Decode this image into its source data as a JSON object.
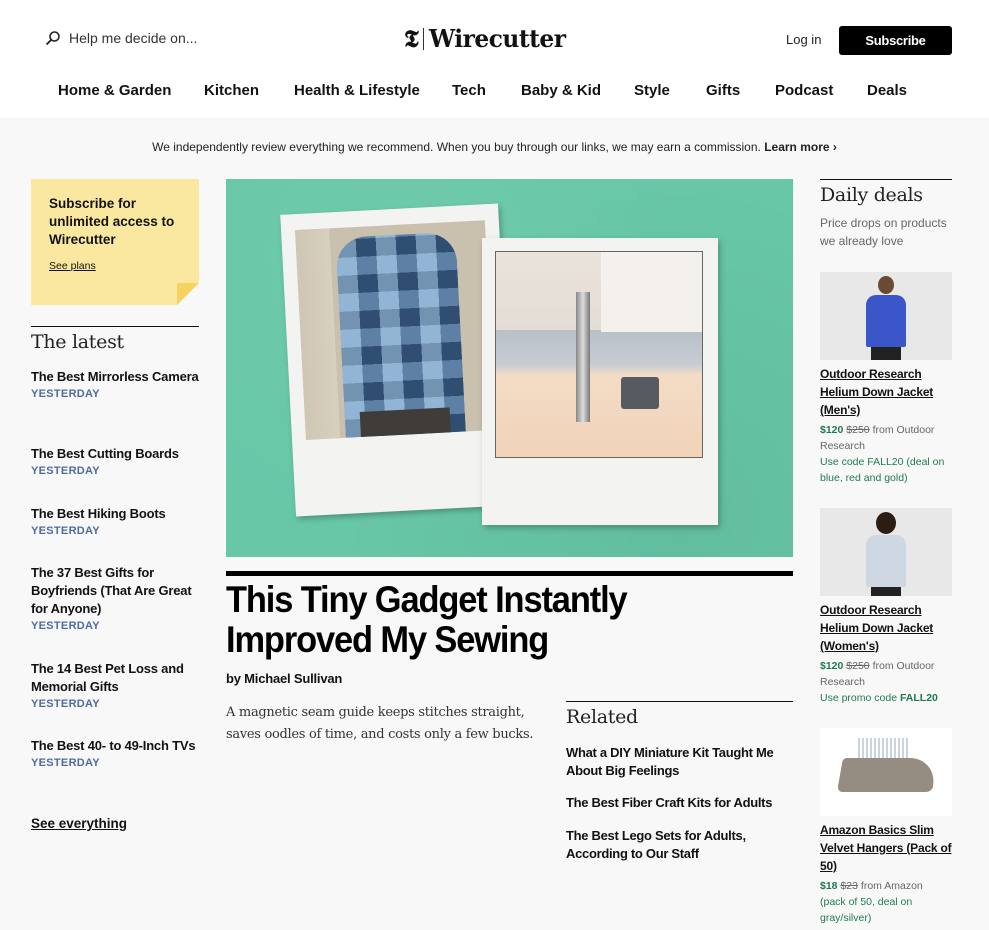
{
  "header": {
    "search_placeholder": "Help me decide on...",
    "logo_mark": "𝕿",
    "logo_text": "Wirecutter",
    "login_label": "Log in",
    "subscribe_label": "Subscribe"
  },
  "nav": [
    {
      "label": "Home & Garden"
    },
    {
      "label": "Kitchen"
    },
    {
      "label": "Health & Lifestyle"
    },
    {
      "label": "Tech"
    },
    {
      "label": "Baby & Kid"
    },
    {
      "label": "Style"
    },
    {
      "label": "Gifts"
    },
    {
      "label": "Podcast"
    },
    {
      "label": "Deals"
    }
  ],
  "disclaimer": {
    "text": "We independently review everything we recommend. When you buy through our links, we may earn a commission.",
    "link": "Learn more ›"
  },
  "promo": {
    "title": "Subscribe for unlimited access to Wirecutter",
    "link": "See plans"
  },
  "latest": {
    "title": "The latest",
    "items": [
      {
        "title": "The Best Mirrorless Camera",
        "date": "YESTERDAY"
      },
      {
        "title": "The Best Cutting Boards",
        "date": "YESTERDAY"
      },
      {
        "title": "The Best Hiking Boots",
        "date": "YESTERDAY"
      },
      {
        "title": "The 37 Best Gifts for Boyfriends (That Are Great for Anyone)",
        "date": "YESTERDAY"
      },
      {
        "title": "The 14 Best Pet Loss and Memorial Gifts",
        "date": "YESTERDAY"
      },
      {
        "title": "The Best 40- to 49-Inch TVs",
        "date": "YESTERDAY"
      }
    ],
    "see_all": "See everything"
  },
  "article": {
    "headline": "This Tiny Gadget Instantly Improved My Sewing",
    "byline": "by Michael Sullivan",
    "dek": "A magnetic seam guide keeps stitches straight, saves oodles of time, and costs only a few bucks."
  },
  "related": {
    "title": "Related",
    "items": [
      {
        "title": "What a DIY Miniature Kit Taught Me About Big Feelings"
      },
      {
        "title": "The Best Fiber Craft Kits for Adults"
      },
      {
        "title": "The Best Lego Sets for Adults, According to Our Staff"
      }
    ]
  },
  "deals": {
    "title": "Daily deals",
    "subtitle": "Price drops on products we already love",
    "items": [
      {
        "name": "Outdoor Research Helium Down Jacket (Men's)",
        "price": "$120",
        "was": "$250",
        "from": "from Outdoor Research",
        "note": "Use code FALL20 (deal on blue, red and gold)",
        "note_bold": ""
      },
      {
        "name": "Outdoor Research Helium Down Jacket (Women's)",
        "price": "$120",
        "was": "$250",
        "from": "from Outdoor Research",
        "note": "Use promo code ",
        "note_bold": "FALL20"
      },
      {
        "name": "Amazon Basics Slim Velvet Hangers (Pack of 50)",
        "price": "$18",
        "was": "$23",
        "from": "from Amazon",
        "note": "(pack of 50, deal on gray/silver)",
        "note_bold": ""
      }
    ]
  },
  "colors": {
    "accent_green": "#1e7a4f",
    "date_blue": "#4f6ba0",
    "promo_yellow": "#fbe8a0",
    "hero_teal": "#67c7a7"
  }
}
